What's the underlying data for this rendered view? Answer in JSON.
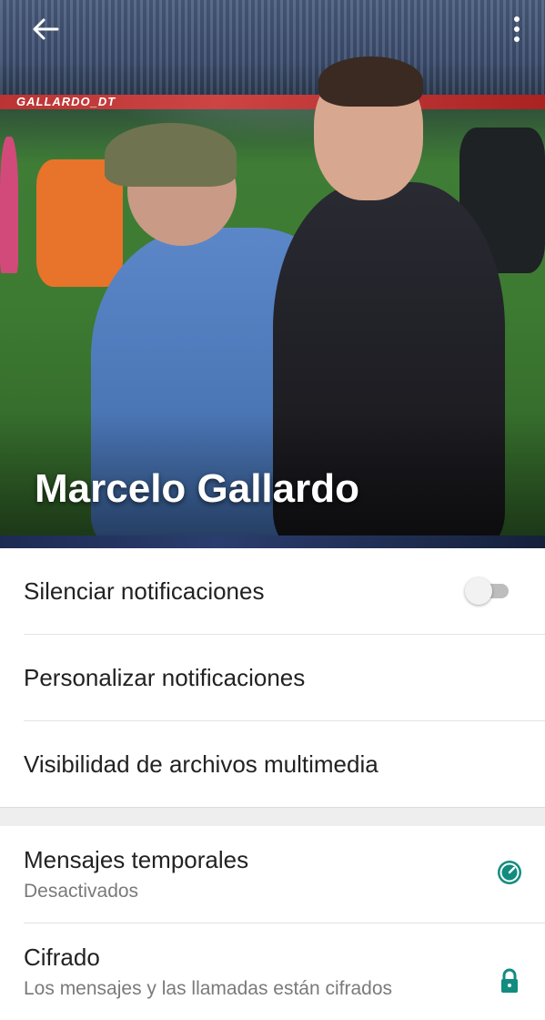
{
  "header": {
    "contact_name": "Marcelo Gallardo",
    "photo_watermark": "GALLARDO_DT"
  },
  "notifications_section": {
    "items": [
      {
        "label": "Silenciar notificaciones",
        "toggle_on": false
      },
      {
        "label": "Personalizar notificaciones"
      },
      {
        "label": "Visibilidad de archivos multimedia"
      }
    ]
  },
  "privacy_section": {
    "items": [
      {
        "title": "Mensajes temporales",
        "subtitle": "Desactivados",
        "icon": "timer-icon"
      },
      {
        "title": "Cifrado",
        "subtitle": "Los mensajes y las llamadas están cifrados",
        "icon": "lock-icon"
      }
    ]
  },
  "colors": {
    "accent": "#128C7E",
    "toggle_track": "#bdbdbd",
    "text_primary": "#222222",
    "text_secondary": "#7a7a7a"
  }
}
